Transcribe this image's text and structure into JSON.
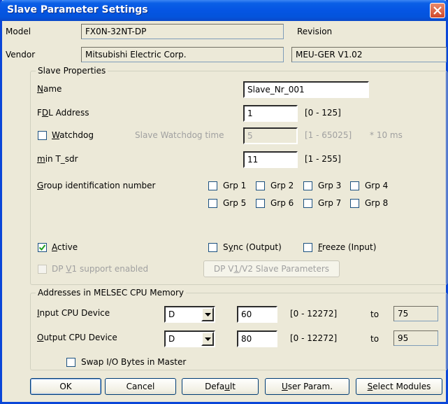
{
  "window": {
    "title": "Slave Parameter Settings"
  },
  "header": {
    "model_label": "Model",
    "model_value": "FX0N-32NT-DP",
    "revision_label": "Revision",
    "vendor_label": "Vendor",
    "vendor_value": "Mitsubishi Electric Corp.",
    "revision_value": "MEU-GER V1.02"
  },
  "slave_properties": {
    "title": "Slave Properties",
    "name_label": "Name",
    "name_value": "Slave_Nr_001",
    "fdl_label": "FDL Address",
    "fdl_value": "1",
    "fdl_range": "[0 - 125]",
    "watchdog_label": "Watchdog",
    "watchdog_checked": false,
    "watchdog_time_label": "Slave Watchdog time",
    "watchdog_time_value": "5",
    "watchdog_range": "[1 - 65025]",
    "watchdog_unit": "* 10 ms",
    "min_tsdr_label": "min T_sdr",
    "min_tsdr_value": "11",
    "min_tsdr_range": "[1 - 255]",
    "group_label": "Group identification number",
    "groups": [
      "Grp 1",
      "Grp 2",
      "Grp 3",
      "Grp 4",
      "Grp 5",
      "Grp 6",
      "Grp 7",
      "Grp 8"
    ],
    "active_label": "Active",
    "active_checked": true,
    "sync_label": "Sync (Output)",
    "freeze_label": "Freeze (Input)",
    "dpv1_label": "DP V1 support enabled",
    "dpv1_button": "DP V1/V2 Slave Parameters"
  },
  "addresses": {
    "title": "Addresses in MELSEC CPU Memory",
    "input_label": "Input CPU Device",
    "input_device": "D",
    "input_value": "60",
    "input_range": "[0 - 12272]",
    "input_to_label": "to",
    "input_to_value": "75",
    "output_label": "Output CPU Device",
    "output_device": "D",
    "output_value": "80",
    "output_range": "[0 - 12272]",
    "output_to_label": "to",
    "output_to_value": "95",
    "swap_label": "Swap I/O Bytes in Master"
  },
  "buttons": {
    "ok": "OK",
    "cancel": "Cancel",
    "default": "Default",
    "user_param": "User Param.",
    "select_modules": "Select Modules"
  },
  "colors": {
    "titlebar": "#0555e3",
    "dialog_bg": "#ece9d8",
    "close_button": "#d0482a"
  }
}
